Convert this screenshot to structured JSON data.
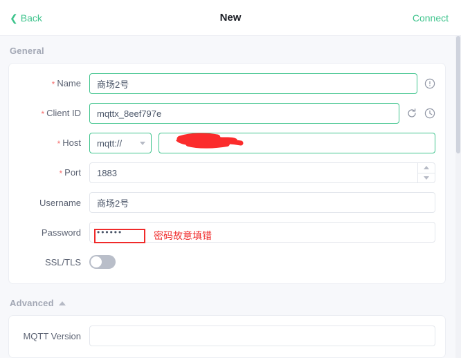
{
  "topbar": {
    "back_label": "Back",
    "back_icon": "chevron-left-icon",
    "title": "New",
    "connect_label": "Connect",
    "accent_color": "#3fc48d"
  },
  "sections": {
    "general": {
      "title": "General"
    },
    "advanced": {
      "title": "Advanced",
      "caret_icon": "caret-up-icon"
    }
  },
  "form": {
    "name": {
      "label": "Name",
      "required_marker": "*",
      "value": "商场2号",
      "placeholder": "",
      "info_icon": "info-circle-icon"
    },
    "client_id": {
      "label": "Client ID",
      "required_marker": "*",
      "value": "mqttx_8eef797e",
      "refresh_icon": "refresh-icon",
      "history_icon": "clock-icon"
    },
    "host": {
      "label": "Host",
      "required_marker": "*",
      "protocol": "mqtt://",
      "protocol_caret_icon": "chevron-down-icon",
      "address_value": "",
      "redacted": true
    },
    "port": {
      "label": "Port",
      "required_marker": "*",
      "value": "1883",
      "stepper_up_icon": "chevron-up-icon",
      "stepper_down_icon": "chevron-down-icon"
    },
    "username": {
      "label": "Username",
      "value": "商场2号"
    },
    "password": {
      "label": "Password",
      "masked_value": "••••••",
      "annotation_text": "密码故意填错",
      "annotation_color": "#f02a2a"
    },
    "ssl_tls": {
      "label": "SSL/TLS",
      "enabled": false
    },
    "advanced_first_row": {
      "label": "MQTT Version",
      "value": ""
    }
  }
}
